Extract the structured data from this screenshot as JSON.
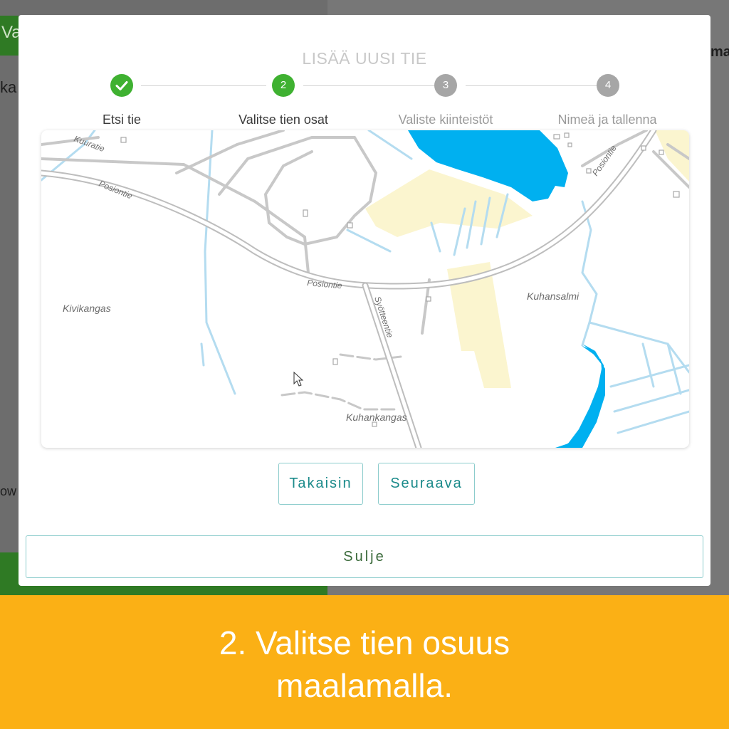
{
  "background": {
    "left_fragment_1": "Va",
    "left_fragment_2": "ka",
    "left_fragment_3": "ow",
    "right_fragment": "mal"
  },
  "modal": {
    "title": "LISÄÄ UUSI TIE",
    "steps": [
      {
        "number": "",
        "label": "Etsi tie",
        "state": "done"
      },
      {
        "number": "2",
        "label": "Valitse tien osat",
        "state": "active"
      },
      {
        "number": "3",
        "label": "Valiste kiinteistöt",
        "state": "todo"
      },
      {
        "number": "4",
        "label": "Nimeä ja tallenna",
        "state": "todo"
      }
    ],
    "map": {
      "labels": {
        "kuuratie": "Kuuratie",
        "posiontie_left": "Posiontie",
        "posiontie_mid": "Posiontie",
        "posiontie_right": "Posiontie",
        "syotteentie": "Syötteentie",
        "kivikangas": "Kivikangas",
        "kuhansalmi": "Kuhansalmi",
        "kuhankangas": "Kuhankangas"
      },
      "colors": {
        "water": "#00b0f0",
        "stream": "#b4dcf0",
        "field": "#fbf5cf",
        "road": "#c8c8c8"
      }
    },
    "back_label": "Takaisin",
    "next_label": "Seuraava",
    "close_label": "Sulje"
  },
  "banner": {
    "line1": "2. Valitse tien osuus",
    "line2": "maalamalla."
  }
}
